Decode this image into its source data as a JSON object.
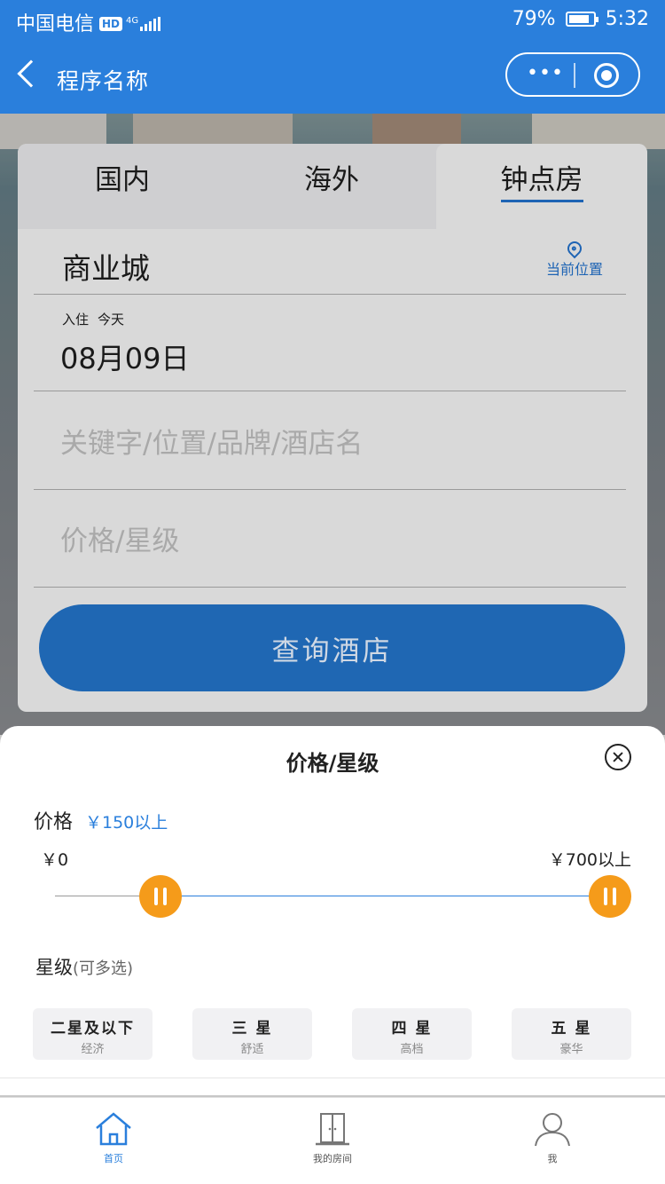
{
  "status_bar": {
    "carrier": "中国电信",
    "hd": "HD",
    "network": "4G",
    "battery": "79%",
    "time": "5:32"
  },
  "nav": {
    "title": "程序名称",
    "more": "•••"
  },
  "tabs": [
    {
      "label": "国内"
    },
    {
      "label": "海外"
    },
    {
      "label": "钟点房"
    }
  ],
  "search_form": {
    "city": "商业城",
    "locate_label": "当前位置",
    "checkin_label": "入住",
    "checkin_day": "今天",
    "checkin_date": "08月09日",
    "keyword_placeholder": "关键字/位置/品牌/酒店名",
    "price_star_placeholder": "价格/星级",
    "submit_label": "查询酒店"
  },
  "filter_sheet": {
    "title": "价格/星级",
    "price_label": "价格",
    "price_selected": "￥150以上",
    "min_label": "￥0",
    "max_label": "￥700以上",
    "range_low_fraction": 0.19,
    "range_high_fraction": 1.0,
    "star_label": "星级",
    "star_hint": "(可多选)",
    "star_options": [
      {
        "label": "二星及以下",
        "desc": "经济"
      },
      {
        "label": "三 星",
        "desc": "舒适"
      },
      {
        "label": "四 星",
        "desc": "高档"
      },
      {
        "label": "五 星",
        "desc": "豪华"
      }
    ]
  },
  "tabbar": [
    {
      "label": "首页",
      "icon": "home-icon"
    },
    {
      "label": "我的房间",
      "icon": "door-icon"
    },
    {
      "label": "我",
      "icon": "user-icon"
    }
  ],
  "colors": {
    "primary": "#2a7fdc",
    "button": "#1f67b3",
    "knob": "#f59b1a"
  }
}
